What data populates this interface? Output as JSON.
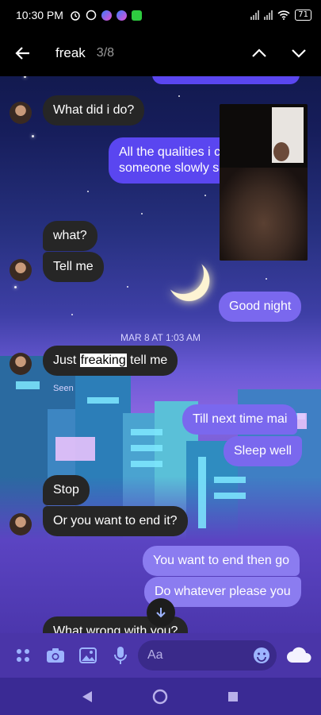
{
  "status_bar": {
    "time": "10:30 PM",
    "battery": "71",
    "icons": [
      "alarm-icon",
      "whatsapp-icon",
      "messenger-icon",
      "messenger-icon",
      "download-icon"
    ]
  },
  "search": {
    "term": "freak",
    "count": "3/8"
  },
  "messages": [
    {
      "id": "m1",
      "side": "in",
      "text": "What did i do?"
    },
    {
      "id": "m2",
      "side": "out",
      "text": "All the qualities i c",
      "text2": "someone slowly s"
    },
    {
      "id": "m3",
      "side": "in",
      "text": "what?"
    },
    {
      "id": "m4",
      "side": "in",
      "text": "Tell me"
    },
    {
      "id": "m5",
      "side": "out",
      "text": "Good night"
    },
    {
      "id": "m6",
      "side": "in",
      "text_before": "Just ",
      "text_highlight": "freaking",
      "text_after": " tell me"
    },
    {
      "id": "m7",
      "side": "out",
      "text": "Till next time mai"
    },
    {
      "id": "m8",
      "side": "out",
      "text": "Sleep well"
    },
    {
      "id": "m9",
      "side": "in",
      "text": "Stop"
    },
    {
      "id": "m10",
      "side": "in",
      "text": "Or you want to end it?"
    },
    {
      "id": "m11",
      "side": "out",
      "text": "You want to end then go"
    },
    {
      "id": "m12",
      "side": "out",
      "text": "Do whatever please you"
    },
    {
      "id": "m13",
      "side": "in",
      "text": "What wrong with you?"
    }
  ],
  "timestamp": "MAR 8 AT 1:03 AM",
  "seen_label": "Seen",
  "composer": {
    "placeholder": "Aa"
  },
  "colors": {
    "incoming_bubble": "#262626",
    "outgoing_bubble": "#5a46f0",
    "search_highlight": "#ffffff"
  }
}
